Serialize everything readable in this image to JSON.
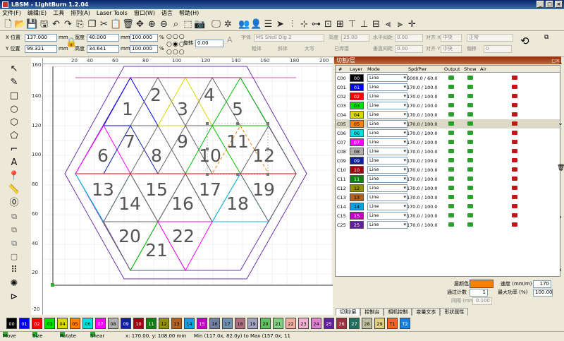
{
  "window": {
    "title": "LBSM - LightBurn 1.2.04"
  },
  "menu": [
    "文件(F)",
    "编辑(E)",
    "工具",
    "排列(A)",
    "Laser Tools",
    "窗口(W)",
    "语言",
    "帮助(H)"
  ],
  "toolbar_icons": [
    "new-file-icon",
    "open-icon",
    "save-icon",
    "save-as-icon",
    "undo-icon",
    "redo-icon",
    "import-icon",
    "copy-icon",
    "cut-icon",
    "paste-icon",
    "delete-icon",
    "move-icon",
    "zoom-in-icon",
    "zoom-out-icon",
    "zoom-frame-icon",
    "frame-select-icon",
    "camera-icon",
    "monitor-icon",
    "settings-icon",
    "users-icon",
    "user-icon",
    "layers-icon",
    "send-icon",
    "align-left-icon",
    "align-center-icon",
    "distribute-icon",
    "group-icon",
    "more-icon"
  ],
  "props": {
    "x_label": "X 位置",
    "x_value": "137.000",
    "y_label": "Y 位置",
    "y_value": "99.321",
    "unit": "mm",
    "width_label": "宽度",
    "width_value": "40.000",
    "height_label": "高度",
    "height_value": "34.641",
    "scale_w": "100.000",
    "scale_h": "100.000",
    "pct": "%",
    "rotate_label": "旋转",
    "rotate_value": "0.00",
    "font_label": "字体",
    "font_value": "MS Shell Dlg 2",
    "fheight_label": "高度",
    "fheight_value": "25.00",
    "hspace_label": "水平间距",
    "hspace_value": "0.00",
    "vspace_label": "垂直间距",
    "vspace_value": "0.00",
    "align_x_label": "对齐 X",
    "align_x_value": "中央",
    "align_y_label": "对齐 Y",
    "align_y_value": "中央",
    "normal_value": "正常",
    "offset_label": "偏移",
    "offset_value": "0",
    "bold": "粗体",
    "italic": "斜体",
    "caps": "大写",
    "welded": "已焊接"
  },
  "rulers": {
    "h": [
      "20",
      "40",
      "60",
      "80",
      "100",
      "120",
      "140",
      "160",
      "180",
      "200"
    ],
    "v": [
      "160",
      "140",
      "120",
      "100",
      "80",
      "60",
      "40",
      "20",
      "0",
      "-20"
    ],
    "h_bottom": [
      "-20",
      "20",
      "40",
      "60",
      "80",
      "100",
      "120",
      "140",
      "160",
      "180",
      "200"
    ]
  },
  "design": {
    "numbers": [
      "1",
      "2",
      "3",
      "4",
      "5",
      "6",
      "7",
      "8",
      "9",
      "10",
      "11",
      "12",
      "13",
      "14",
      "15",
      "16",
      "17",
      "18",
      "19",
      "20",
      "21",
      "22"
    ]
  },
  "panel": {
    "title": "切割/层",
    "columns": [
      "#",
      "Layer",
      "Mode",
      "Spd/Pwr",
      "Output",
      "Show",
      "Air"
    ],
    "rows": [
      {
        "num": "C00",
        "layer": "00",
        "color": "#000000",
        "text": "#ffffff",
        "mode": "Line",
        "spd": "6000.0 / 60.0",
        "sel": false
      },
      {
        "num": "C01",
        "layer": "01",
        "color": "#0000ff",
        "text": "#ffffff",
        "mode": "Line",
        "spd": "170.0 / 100.0",
        "sel": false
      },
      {
        "num": "C02",
        "layer": "02",
        "color": "#ff0000",
        "text": "#ffffff",
        "mode": "Line",
        "spd": "170.0 / 100.0",
        "sel": false
      },
      {
        "num": "C03",
        "layer": "03",
        "color": "#00e000",
        "text": "#000000",
        "mode": "Line",
        "spd": "170.0 / 100.0",
        "sel": false
      },
      {
        "num": "C04",
        "layer": "04",
        "color": "#d8d800",
        "text": "#000000",
        "mode": "Line",
        "spd": "170.0 / 100.0",
        "sel": false
      },
      {
        "num": "C05",
        "layer": "05",
        "color": "#ff8000",
        "text": "#000000",
        "mode": "Line",
        "spd": "170.0 / 100.0",
        "sel": true
      },
      {
        "num": "C06",
        "layer": "06",
        "color": "#00e0e0",
        "text": "#000000",
        "mode": "Line",
        "spd": "170.0 / 100.0",
        "sel": false
      },
      {
        "num": "C07",
        "layer": "07",
        "color": "#ff00ff",
        "text": "#ffffff",
        "mode": "Line",
        "spd": "170.0 / 100.0",
        "sel": false
      },
      {
        "num": "C08",
        "layer": "08",
        "color": "#b0b0b0",
        "text": "#000000",
        "mode": "Line",
        "spd": "170.0 / 100.0",
        "sel": false
      },
      {
        "num": "C09",
        "layer": "09",
        "color": "#1020a0",
        "text": "#ffffff",
        "mode": "Line",
        "spd": "170.0 / 100.0",
        "sel": false
      },
      {
        "num": "C10",
        "layer": "10",
        "color": "#a00010",
        "text": "#ffffff",
        "mode": "Line",
        "spd": "170.0 / 100.0",
        "sel": false
      },
      {
        "num": "C11",
        "layer": "11",
        "color": "#108010",
        "text": "#ffffff",
        "mode": "Line",
        "spd": "170.0 / 100.0",
        "sel": false
      },
      {
        "num": "C12",
        "layer": "12",
        "color": "#909000",
        "text": "#000000",
        "mode": "Line",
        "spd": "170.0 / 100.0",
        "sel": false
      },
      {
        "num": "C13",
        "layer": "13",
        "color": "#b06020",
        "text": "#000000",
        "mode": "Line",
        "spd": "170.0 / 100.0",
        "sel": false
      },
      {
        "num": "C14",
        "layer": "14",
        "color": "#10a0e0",
        "text": "#000000",
        "mode": "Line",
        "spd": "170.0 / 100.0",
        "sel": false
      },
      {
        "num": "C15",
        "layer": "15",
        "color": "#c000c0",
        "text": "#ffffff",
        "mode": "Line",
        "spd": "170.0 / 100.0",
        "sel": false
      },
      {
        "num": "C25",
        "layer": "25",
        "color": "#6020a0",
        "text": "#ffffff",
        "mode": "Line",
        "spd": "170.0 / 100.0",
        "sel": false
      }
    ],
    "layer_color_label": "层颜色",
    "layer_color": "#ff8000",
    "speed_label": "速度 (mm/m)",
    "speed_value": "170",
    "passes_label": "通过计数",
    "passes_value": "1",
    "maxpower_label": "最大功率 (%)",
    "maxpower_value": "100.00",
    "interval_label": "间隔 (mm)",
    "interval_value": "0.100",
    "tabs": [
      "切割/层",
      "控制台",
      "相机控制",
      "变量文本",
      "形状属性"
    ]
  },
  "palette": [
    {
      "l": "00",
      "c": "#000000",
      "t": "#ffffff"
    },
    {
      "l": "01",
      "c": "#0000ff",
      "t": "#ffffff"
    },
    {
      "l": "02",
      "c": "#ff0000",
      "t": "#ffffff"
    },
    {
      "l": "03",
      "c": "#00e000",
      "t": "#000"
    },
    {
      "l": "04",
      "c": "#d8d800",
      "t": "#000"
    },
    {
      "l": "05",
      "c": "#ff8000",
      "t": "#000"
    },
    {
      "l": "06",
      "c": "#00e0e0",
      "t": "#000"
    },
    {
      "l": "07",
      "c": "#ff00ff",
      "t": "#fff"
    },
    {
      "l": "08",
      "c": "#b0b0b0",
      "t": "#000"
    },
    {
      "l": "09",
      "c": "#1020a0",
      "t": "#fff"
    },
    {
      "l": "10",
      "c": "#a00010",
      "t": "#fff"
    },
    {
      "l": "11",
      "c": "#108010",
      "t": "#fff"
    },
    {
      "l": "12",
      "c": "#909000",
      "t": "#000"
    },
    {
      "l": "13",
      "c": "#b06020",
      "t": "#000"
    },
    {
      "l": "14",
      "c": "#10a0e0",
      "t": "#000"
    },
    {
      "l": "15",
      "c": "#c000c0",
      "t": "#fff"
    },
    {
      "l": "16",
      "c": "#7080a0",
      "t": "#000"
    },
    {
      "l": "17",
      "c": "#7090b0",
      "t": "#000"
    },
    {
      "l": "18",
      "c": "#b07080",
      "t": "#000"
    },
    {
      "l": "19",
      "c": "#a0a0c0",
      "t": "#000"
    },
    {
      "l": "20",
      "c": "#60c060",
      "t": "#000"
    },
    {
      "l": "21",
      "c": "#80d080",
      "t": "#000"
    },
    {
      "l": "22",
      "c": "#f0b0a0",
      "t": "#000"
    },
    {
      "l": "23",
      "c": "#f0b0d0",
      "t": "#000"
    },
    {
      "l": "24",
      "c": "#e080d0",
      "t": "#000"
    },
    {
      "l": "25",
      "c": "#6020a0",
      "t": "#fff"
    },
    {
      "l": "26",
      "c": "#a03040",
      "t": "#fff"
    },
    {
      "l": "27",
      "c": "#207060",
      "t": "#fff"
    },
    {
      "l": "28",
      "c": "#c0c0a0",
      "t": "#000"
    },
    {
      "l": "29",
      "c": "#e0d080",
      "t": "#000"
    },
    {
      "l": "T1",
      "c": "#ff6020",
      "t": "#000"
    },
    {
      "l": "T2",
      "c": "#2080e0",
      "t": "#fff"
    }
  ],
  "status": {
    "move": "Move",
    "size": "Size",
    "rotate": "Rotate",
    "shear": "Shear",
    "coords": "x: 170.00, y: 108.00 mm",
    "range": "Min (117.0x, 82.0y) to Max (157.0x, 11"
  }
}
